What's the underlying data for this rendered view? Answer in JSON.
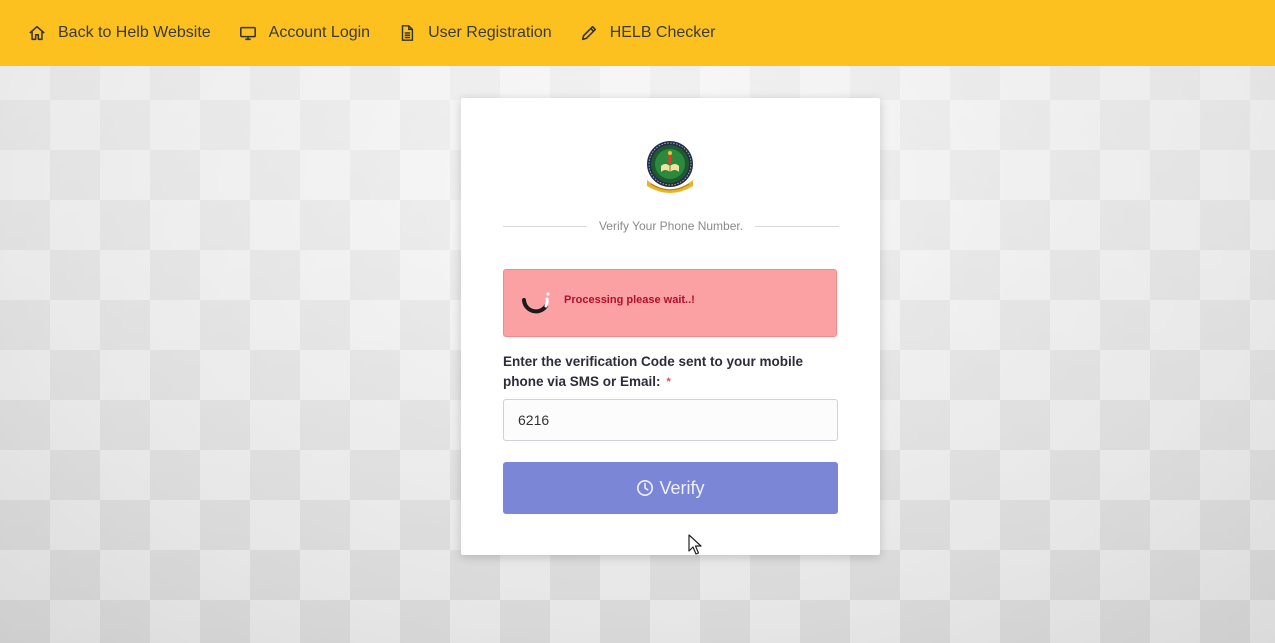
{
  "nav": {
    "items": [
      {
        "label": "Back to Helb Website",
        "icon": "home-icon"
      },
      {
        "label": "Account Login",
        "icon": "monitor-icon"
      },
      {
        "label": "User Registration",
        "icon": "document-icon"
      },
      {
        "label": "HELB Checker",
        "icon": "pencil-icon"
      }
    ]
  },
  "card": {
    "logo_icon": "helb-seal-icon",
    "divider_text": "Verify Your Phone Number.",
    "alert": {
      "text": "Processing please wait..!",
      "icon": "spinner-icon"
    },
    "field": {
      "label": "Enter the verification Code sent to your mobile phone via SMS or Email:",
      "required_mark": "*",
      "value": "6216"
    },
    "verify_button": {
      "label": "Verify",
      "icon": "clock-icon"
    }
  },
  "colors": {
    "topbar": "#fcc11f",
    "alert_bg": "#fba1a4",
    "alert_text": "#b0102a",
    "button": "#7b86d6"
  }
}
